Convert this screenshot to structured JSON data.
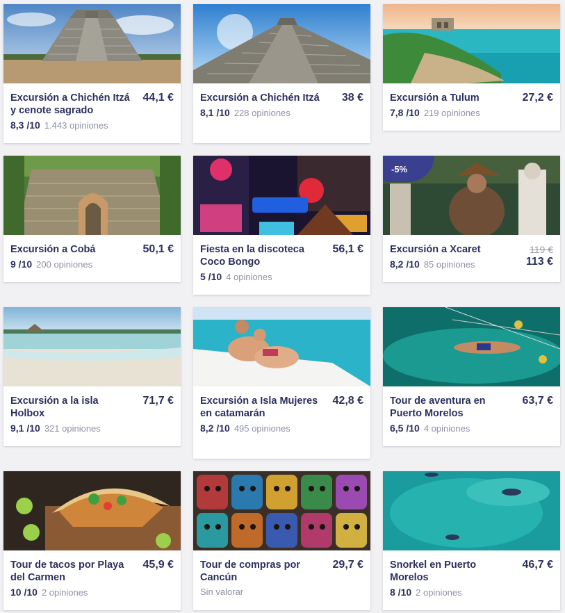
{
  "tours": [
    {
      "title": "Excursión a Chichén Itzá y cenote sagrado",
      "price": "44,1 €",
      "score": "8,3 /10",
      "reviews": "1.443 opiniones",
      "image": "chichen-itza-pyramid-photo"
    },
    {
      "title": "Excursión a Chichén Itzá",
      "price": "38 €",
      "score": "8,1 /10",
      "reviews": "228 opiniones",
      "image": "chichen-itza-steps-photo"
    },
    {
      "title": "Excursión a Tulum",
      "price": "27,2 €",
      "score": "7,8 /10",
      "reviews": "219 opiniones",
      "image": "tulum-coast-photo"
    },
    {
      "title": "Excursión a Cobá",
      "price": "50,1 €",
      "score": "9 /10",
      "reviews": "200 opiniones",
      "image": "coba-ruins-photo"
    },
    {
      "title": "Fiesta en la discoteca Coco Bongo",
      "price": "56,1 €",
      "score": "5 /10",
      "reviews": "4 opiniones",
      "image": "coco-bongo-nightlife-photo"
    },
    {
      "title": "Excursión a Xcaret",
      "price": "113 €",
      "old_price": "119 €",
      "discount": "-5%",
      "score": "8,2 /10",
      "reviews": "85 opiniones",
      "image": "xcaret-show-photo"
    },
    {
      "title": "Excursión a la isla Holbox",
      "price": "71,7 €",
      "score": "9,1 /10",
      "reviews": "321 opiniones",
      "image": "holbox-beach-photo"
    },
    {
      "title": "Excursión a Isla Mujeres en catamarán",
      "price": "42,8 €",
      "score": "8,2 /10",
      "reviews": "495 opiniones",
      "image": "catamaran-couple-photo"
    },
    {
      "title": "Tour de aventura en Puerto Morelos",
      "price": "63,7 €",
      "score": "6,5 /10",
      "reviews": "4 opiniones",
      "image": "zipline-cenote-photo"
    },
    {
      "title": "Tour de tacos por Playa del Carmen",
      "price": "45,9 €",
      "score": "10 /10",
      "reviews": "2 opiniones",
      "image": "tacos-photo"
    },
    {
      "title": "Tour de compras por Cancún",
      "price": "29,7 €",
      "unrated": "Sin valorar",
      "image": "mayan-masks-photo"
    },
    {
      "title": "Snorkel en Puerto Morelos",
      "price": "46,7 €",
      "score": "8 /10",
      "reviews": "2 opiniones",
      "image": "snorkel-photo"
    }
  ],
  "colors": {
    "text": "#2b2f5e",
    "muted": "#8f92a3",
    "badge": "#3a3f8f",
    "background": "#f1f1f3"
  }
}
